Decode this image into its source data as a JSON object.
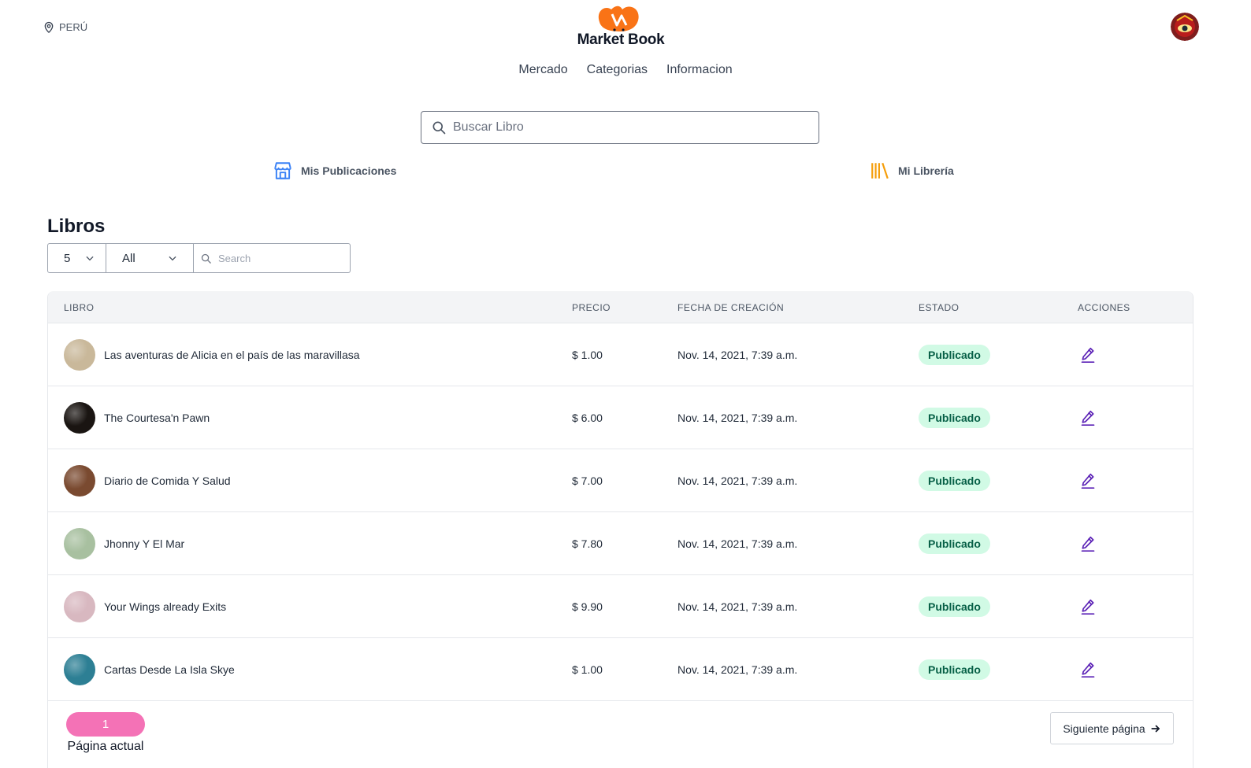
{
  "header": {
    "location": "PERÚ",
    "logo_text": "Market Book"
  },
  "nav": {
    "items": [
      {
        "label": "Mercado"
      },
      {
        "label": "Categorias"
      },
      {
        "label": "Informacion"
      }
    ]
  },
  "search": {
    "placeholder": "Buscar Libro"
  },
  "quicklinks": {
    "publications": "Mis Publicaciones",
    "library": "Mi Librería"
  },
  "books": {
    "title": "Libros",
    "per_page": "5",
    "filter": "All",
    "search_placeholder": "Search",
    "columns": {
      "book": "LIBRO",
      "price": "PRECIO",
      "created": "FECHA DE CREACIÓN",
      "status": "ESTADO",
      "actions": "ACCIONES"
    },
    "rows": [
      {
        "title": "Las aventuras de Alicia en el país de las maravillasa",
        "price": "$ 1.00",
        "created": "Nov. 14, 2021, 7:39 a.m.",
        "status": "Publicado",
        "cover_color": "#c9b89a"
      },
      {
        "title": "The Courtesa'n Pawn",
        "price": "$ 6.00",
        "created": "Nov. 14, 2021, 7:39 a.m.",
        "status": "Publicado",
        "cover_color": "#1a1512"
      },
      {
        "title": "Diario de Comida Y Salud",
        "price": "$ 7.00",
        "created": "Nov. 14, 2021, 7:39 a.m.",
        "status": "Publicado",
        "cover_color": "#7a4a30"
      },
      {
        "title": "Jhonny Y El Mar",
        "price": "$ 7.80",
        "created": "Nov. 14, 2021, 7:39 a.m.",
        "status": "Publicado",
        "cover_color": "#a8c0a0"
      },
      {
        "title": "Your Wings already Exits",
        "price": "$ 9.90",
        "created": "Nov. 14, 2021, 7:39 a.m.",
        "status": "Publicado",
        "cover_color": "#d8b8c0"
      },
      {
        "title": "Cartas Desde La Isla Skye",
        "price": "$ 1.00",
        "created": "Nov. 14, 2021, 7:39 a.m.",
        "status": "Publicado",
        "cover_color": "#2d7f94"
      }
    ]
  },
  "pagination": {
    "current": "1",
    "current_label": "Página actual",
    "next": "Siguiente página"
  },
  "colors": {
    "accent_pink": "#f472b6",
    "badge_bg": "#d1fae5",
    "badge_text": "#065f46",
    "edit_icon": "#5b21b6",
    "store_icon": "#3b82f6",
    "library_icon": "#f59e0b",
    "logo_orange": "#f97316"
  },
  "icons": {
    "location": "map-pin-icon",
    "search": "search-icon",
    "publications": "storefront-icon",
    "library": "books-icon",
    "dropdown": "chevron-down-icon",
    "edit": "pencil-icon",
    "next": "arrow-right-icon"
  }
}
